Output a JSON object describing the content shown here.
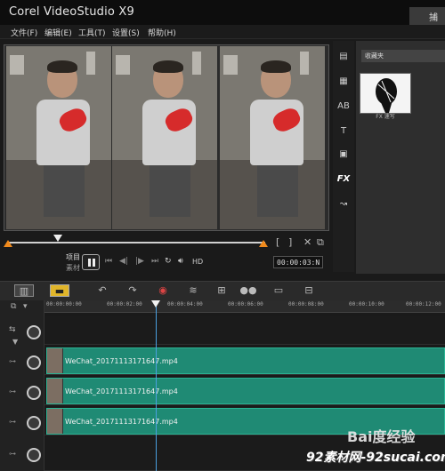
{
  "window": {
    "title": "Corel VideoStudio X9",
    "capture_tab": "捕获"
  },
  "menu": [
    "文件(F)",
    "编辑(E)",
    "工具(T)",
    "设置(S)",
    "帮助(H)"
  ],
  "player": {
    "mode_project": "项目",
    "mode_clip": "素材",
    "timecode": "00:00:03:N",
    "hd_label": "HD",
    "buttons": {
      "in": "[",
      "out": "]"
    }
  },
  "library": {
    "category": "收藏夹",
    "thumbnail_caption": "FX 速写"
  },
  "side_tools": [
    "media-icon",
    "instant-project-icon",
    "transition-icon",
    "title-icon",
    "graphic-icon",
    "FX",
    "path-icon"
  ],
  "ruler": [
    "00:00:00:00",
    "00:00:02:00",
    "00:00:04:00",
    "00:00:06:00",
    "00:00:08:00",
    "00:00:10:00",
    "00:00:12:00"
  ],
  "tracks": [
    {
      "clip": "WeChat_20171113171647.mp4"
    },
    {
      "clip": "WeChat_20171113171647.mp4"
    },
    {
      "clip": "WeChat_20171113171647.mp4"
    }
  ],
  "watermark": {
    "line1": "Bai度经验",
    "line2": "92素材网-92sucai.com"
  }
}
